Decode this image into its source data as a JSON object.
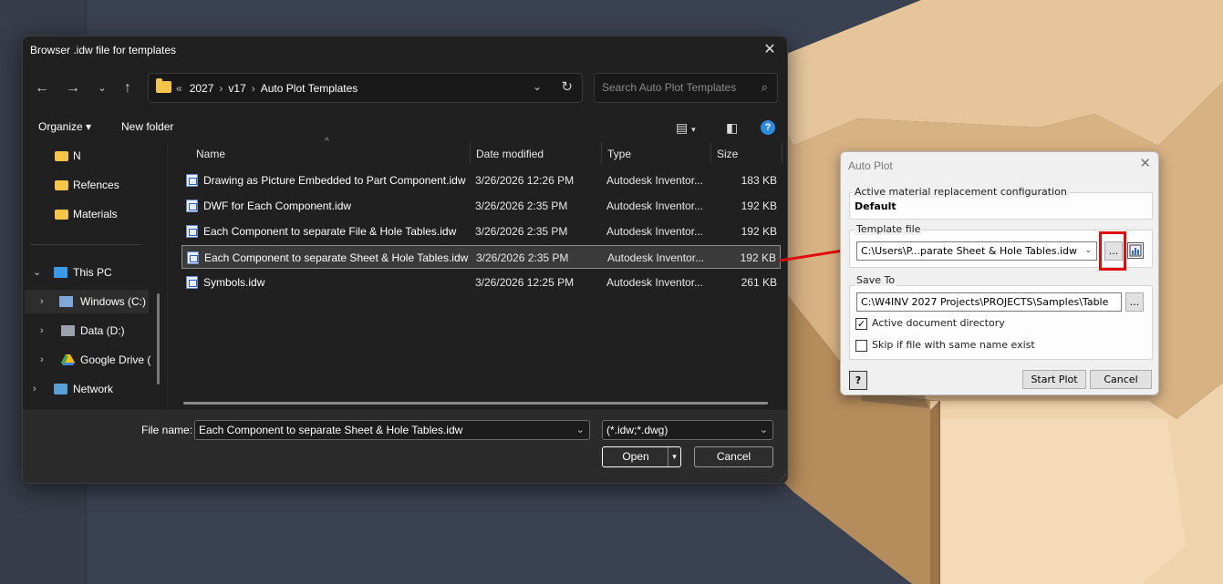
{
  "file_dialog": {
    "title": "Browser .idw file for templates",
    "breadcrumb": [
      "2027",
      "v17",
      "Auto Plot Templates"
    ],
    "search_placeholder": "Search Auto Plot Templates",
    "toolbar": {
      "organize_label": "Organize ▾",
      "new_folder_label": "New folder"
    },
    "nav": {
      "quick_items": [
        "N",
        "Refences",
        "Materials"
      ],
      "this_pc_label": "This PC",
      "drives": [
        "Windows (C:)",
        "Data (D:)",
        "Google Drive ("
      ],
      "network_label": "Network"
    },
    "columns": {
      "name": "Name",
      "date": "Date modified",
      "type": "Type",
      "size": "Size"
    },
    "files": [
      {
        "name": "Drawing as Picture Embedded to Part Component.idw",
        "date": "3/26/2026 12:26 PM",
        "type": "Autodesk Inventor...",
        "size": "183 KB"
      },
      {
        "name": "DWF for Each Component.idw",
        "date": "3/26/2026 2:35 PM",
        "type": "Autodesk Inventor...",
        "size": "192 KB"
      },
      {
        "name": "Each Component to separate File & Hole Tables.idw",
        "date": "3/26/2026 2:35 PM",
        "type": "Autodesk Inventor...",
        "size": "192 KB"
      },
      {
        "name": "Each Component to separate Sheet & Hole Tables.idw",
        "date": "3/26/2026 2:35 PM",
        "type": "Autodesk Inventor...",
        "size": "192 KB",
        "selected": true
      },
      {
        "name": "Symbols.idw",
        "date": "3/26/2026 12:25 PM",
        "type": "Autodesk Inventor...",
        "size": "261 KB"
      }
    ],
    "file_name_label": "File name:",
    "file_name_value": "Each Component to separate Sheet & Hole Tables.idw",
    "file_type_value": "(*.idw;*.dwg)",
    "open_label": "Open",
    "cancel_label": "Cancel"
  },
  "auto_plot": {
    "title": "Auto Plot",
    "material_config_label": "Active material replacement configuration",
    "material_config_value": "Default",
    "template_label": "Template file",
    "template_value": "C:\\Users\\P...parate Sheet & Hole Tables.idw",
    "browse_label": "...",
    "save_to_label": "Save To",
    "save_to_value": "C:\\W4INV 2027 Projects\\PROJECTS\\Samples\\Table",
    "active_dir_label": "Active document directory",
    "active_dir_checked": true,
    "skip_label": "Skip if file with same name exist",
    "skip_checked": false,
    "help_label": "?",
    "start_label": "Start Plot",
    "cancel_label": "Cancel"
  },
  "colors": {
    "highlight": "#e10c0c",
    "folder": "#f5c54a"
  }
}
